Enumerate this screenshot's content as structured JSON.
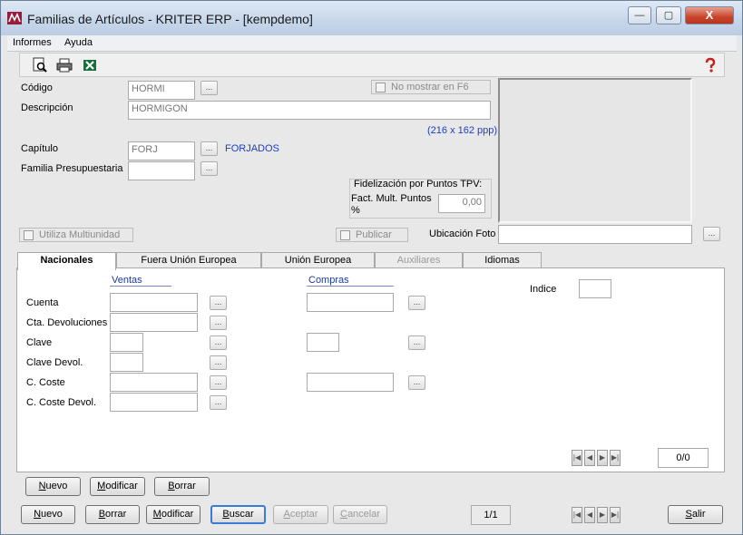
{
  "window": {
    "title": "Familias de Artículos - KRITER ERP - [kempdemo]",
    "minimize": "—",
    "maximize": "▢",
    "close": "X"
  },
  "menu": [
    "Informes",
    "Ayuda"
  ],
  "toolbar": {
    "icons": [
      "preview-icon",
      "print-icon",
      "excel-icon",
      "help-icon"
    ]
  },
  "form": {
    "codigo_label": "Código",
    "codigo_value": "HORMI",
    "descripcion_label": "Descripción",
    "descripcion_value": "HORMIGON",
    "no_mostrar_label": "No mostrar en F6",
    "image_size": "(216 x 162 ppp)",
    "capitulo_label": "Capítulo",
    "capitulo_value": "FORJ",
    "capitulo_desc": "FORJADOS",
    "familia_presupuestaria_label": "Familia Presupuestaria",
    "familia_presupuestaria_value": "",
    "fidelizacion_label": "Fidelización por Puntos TPV:",
    "fact_mult_label": "Fact. Mult. Puntos",
    "fact_mult_unit": "%",
    "fact_mult_value": "0,00",
    "utiliza_multiunidad_label": "Utiliza Multiunidad",
    "publicar_label": "Publicar",
    "ubicacion_foto_label": "Ubicación Foto",
    "ubicacion_foto_value": "",
    "dots": "..."
  },
  "tabs": [
    {
      "label": "Nacionales",
      "state": "active"
    },
    {
      "label": "Fuera Unión Europea",
      "state": "normal"
    },
    {
      "label": "Unión Europea",
      "state": "normal"
    },
    {
      "label": "Auxiliares",
      "state": "disabled"
    },
    {
      "label": "Idiomas",
      "state": "normal"
    }
  ],
  "nacionales": {
    "ventas_header": "Ventas",
    "compras_header": "Compras",
    "indice_label": "Indice",
    "rows": [
      "Cuenta",
      "Cta. Devoluciones",
      "Clave",
      "Clave Devol.",
      "C. Coste",
      "C. Coste Devol."
    ],
    "counter": "0/0"
  },
  "tab_buttons": [
    "Nuevo",
    "Modificar",
    "Borrar"
  ],
  "bottom_buttons": [
    "Nuevo",
    "Borrar",
    "Modificar",
    "Buscar",
    "Aceptar",
    "Cancelar"
  ],
  "record_counter": "1/1",
  "salir": "Salir"
}
